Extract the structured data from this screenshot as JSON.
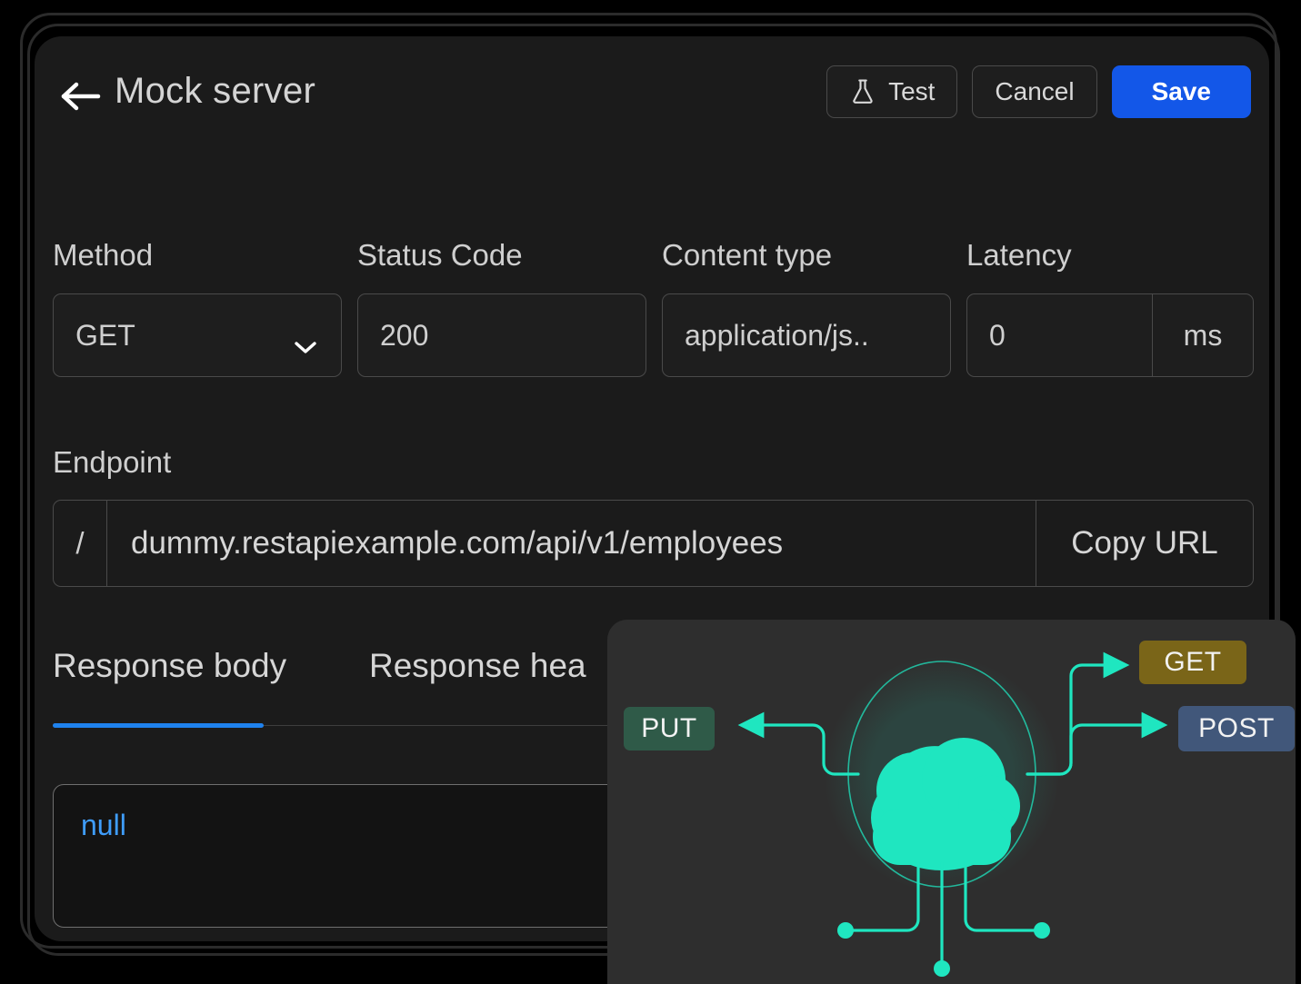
{
  "header": {
    "back_icon": "arrow-left-icon",
    "title": "Mock server",
    "buttons": {
      "test_label": "Test",
      "test_icon": "flask-icon",
      "cancel_label": "Cancel",
      "save_label": "Save"
    }
  },
  "form": {
    "method": {
      "label": "Method",
      "value": "GET",
      "chevron_icon": "chevron-down-icon"
    },
    "status_code": {
      "label": "Status Code",
      "value": "200"
    },
    "content_type": {
      "label": "Content type",
      "value": "application/js.."
    },
    "latency": {
      "label": "Latency",
      "value": "0",
      "unit": "ms"
    }
  },
  "endpoint": {
    "label": "Endpoint",
    "prefix": "/",
    "url": "dummy.restapiexample.com/api/v1/employees",
    "copy_label": "Copy URL"
  },
  "tabs": [
    {
      "label": "Response body",
      "active": true
    },
    {
      "label": "Response hea",
      "active": false
    }
  ],
  "response_body": {
    "value": "null"
  },
  "diagram": {
    "cloud_icon": "cloud-icon",
    "badges": [
      {
        "label": "GET",
        "color": "#7a6518"
      },
      {
        "label": "POST",
        "color": "#41577a"
      },
      {
        "label": "PUT",
        "color": "#2f5a48"
      }
    ],
    "accent_color": "#1fe6c0"
  },
  "colors": {
    "panel_bg": "#1b1b1b",
    "overlay_bg": "#2e2e2e",
    "primary": "#1357e8",
    "tab_active": "#1f82ee",
    "code_text": "#3f9dfb"
  }
}
